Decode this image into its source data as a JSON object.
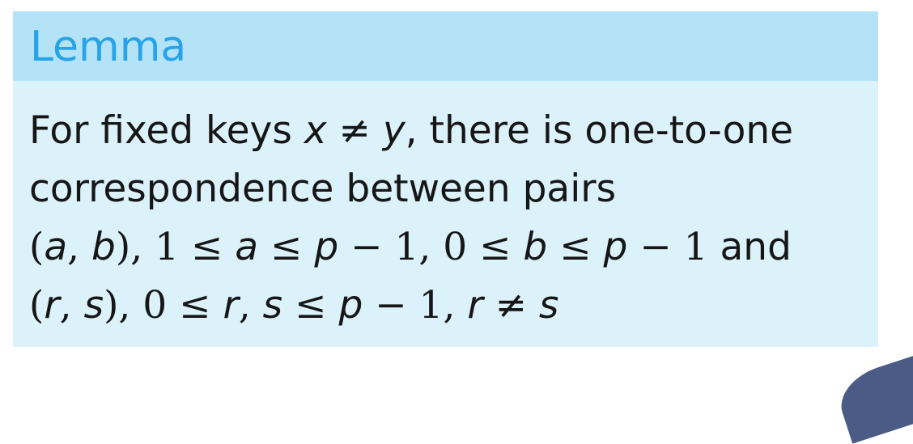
{
  "lemma": {
    "title": "Lemma",
    "line1": {
      "t1": "For fixed keys ",
      "x": "x",
      "neq": " ≠ ",
      "y": "y",
      "t2": ", there is one-to-one"
    },
    "line2": {
      "t1": "correspondence between pairs"
    },
    "line3": {
      "open": "(",
      "a": "a",
      "comma1": ", ",
      "b": "b",
      "close": ")",
      "m1": ", 1 ≤ ",
      "a2": "a",
      "m2": " ≤ ",
      "p1": "p",
      "m3": " − 1, 0 ≤ ",
      "b2": "b",
      "m4": " ≤ ",
      "p2": "p",
      "m5": " − 1",
      "t_and": " and"
    },
    "line4": {
      "open": "(",
      "r": "r",
      "comma1": ", ",
      "s": "s",
      "close": ")",
      "m1": ", 0 ≤ ",
      "r2": "r",
      "comma2": ", ",
      "s2": "s",
      "m2": " ≤ ",
      "p": "p",
      "m3": " − 1, ",
      "r3": "r",
      "neq": " ≠ ",
      "s3": "s"
    }
  },
  "colors": {
    "header_bg": "#b4e3f7",
    "body_bg": "#dcf2fb",
    "title": "#27a3e8",
    "text": "#161616"
  }
}
